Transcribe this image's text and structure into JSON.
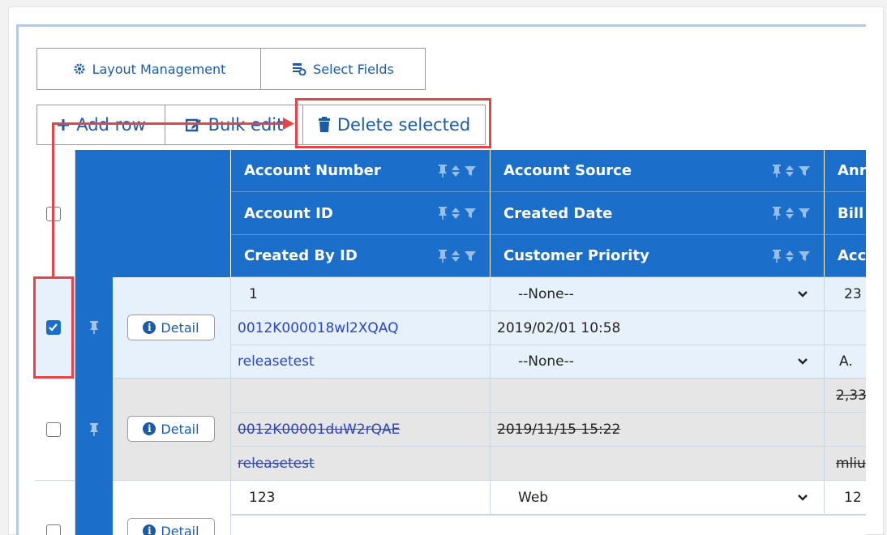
{
  "toolbar1": {
    "layout_management": "Layout Management",
    "select_fields": "Select Fields"
  },
  "toolbar2": {
    "add_row": "Add row",
    "bulk_edit": "Bulk edit",
    "delete_selected": "Delete selected"
  },
  "columns": {
    "col1": [
      "Account Number",
      "Account ID",
      "Created By ID"
    ],
    "col2": [
      "Account Source",
      "Created Date",
      "Customer Priority"
    ],
    "col3": [
      "Anr",
      "Bill",
      "Acc"
    ]
  },
  "rows": [
    {
      "checked": true,
      "detail_label": "Detail",
      "col1": [
        "1",
        "0012K000018wl2XQAQ",
        "releasetest"
      ],
      "col2": [
        "--None--",
        "2019/02/01 10:58",
        "--None--"
      ],
      "col3": [
        "23",
        "",
        "A."
      ]
    },
    {
      "checked": false,
      "detail_label": "Detail",
      "col1": [
        "",
        "0012K00001duW2rQAE",
        "releasetest"
      ],
      "col2": [
        "",
        "2019/11/15 15:22",
        ""
      ],
      "col3": [
        "2,33",
        "",
        "mliu"
      ]
    },
    {
      "checked": false,
      "detail_label": "Detail",
      "col1": [
        "123",
        "",
        ""
      ],
      "col2": [
        "Web",
        "",
        ""
      ],
      "col3": [
        "12",
        "",
        ""
      ]
    }
  ],
  "colors": {
    "header_blue": "#1b6ec9",
    "highlight_red": "#e84447",
    "row_selected": "#e7f1fb",
    "row_deleted": "#e6e6e6",
    "link": "#2a45c9"
  },
  "icons": {
    "layout_management": "gear-icon",
    "select_fields": "table-settings-icon",
    "add_row": "plus-icon",
    "bulk_edit": "edit-icon",
    "delete_selected": "trash-icon",
    "detail": "info-icon",
    "pin": "pin-icon",
    "sort": "sort-icon",
    "filter": "filter-icon",
    "dropdown": "chevron-down-icon"
  }
}
